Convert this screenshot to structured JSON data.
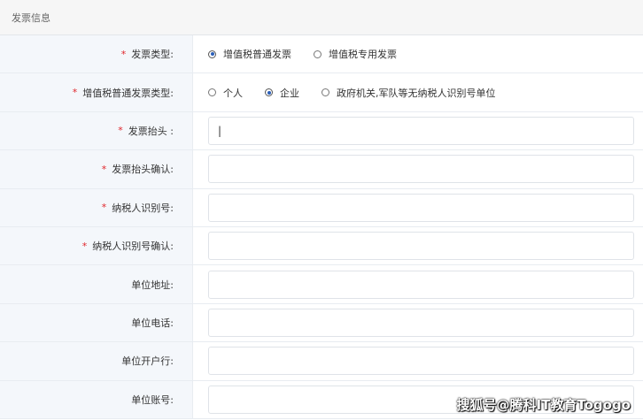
{
  "section": {
    "title": "发票信息"
  },
  "rows": [
    {
      "required": "*",
      "label": "发票类型:",
      "type": "radio",
      "options": [
        {
          "label": "增值税普通发票",
          "checked": true
        },
        {
          "label": "增值税专用发票",
          "checked": false
        }
      ]
    },
    {
      "required": "*",
      "label": "增值税普通发票类型:",
      "type": "radio",
      "options": [
        {
          "label": "个人",
          "checked": false
        },
        {
          "label": "企业",
          "checked": true
        },
        {
          "label": "政府机关,军队等无纳税人识别号单位",
          "checked": false
        }
      ]
    },
    {
      "required": "*",
      "label": "发票抬头 :",
      "type": "input",
      "value": "|"
    },
    {
      "required": "*",
      "label": "发票抬头确认:",
      "type": "input",
      "value": ""
    },
    {
      "required": "*",
      "label": "纳税人识别号:",
      "type": "input",
      "value": ""
    },
    {
      "required": "*",
      "label": "纳税人识别号确认:",
      "type": "input",
      "value": ""
    },
    {
      "required": "",
      "label": "单位地址:",
      "type": "input",
      "value": ""
    },
    {
      "required": "",
      "label": "单位电话:",
      "type": "input",
      "value": ""
    },
    {
      "required": "",
      "label": "单位开户行:",
      "type": "input",
      "value": ""
    },
    {
      "required": "",
      "label": "单位账号:",
      "type": "input",
      "value": ""
    }
  ],
  "watermark": "搜狐号@腾科IT教育Togogo"
}
